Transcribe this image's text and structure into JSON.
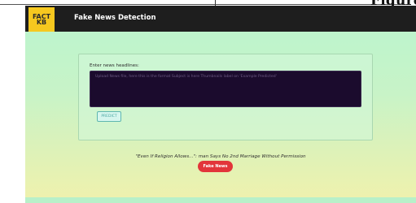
{
  "page": {
    "figure_caption_fragment": "Figure"
  },
  "navbar": {
    "logo_text": "FACT\nKB",
    "brand_title": "Fake News Detection"
  },
  "form": {
    "label": "Enter news headlines:",
    "textarea_placeholder": "Upload News file, here this is the format Subject is here Thumbnails label on 'Example Predicted'",
    "predict_label": "PREDICT"
  },
  "result": {
    "headline": "\"Even If Religion Allows...\": man Says No 2nd Marriage Without Permission",
    "prediction": "Fake News",
    "prediction_color": "#e2353a"
  },
  "theme": {
    "navbar_bg": "#1e1e1e",
    "logo_bg": "#f6c81f",
    "textarea_bg": "#1b0b2d"
  }
}
